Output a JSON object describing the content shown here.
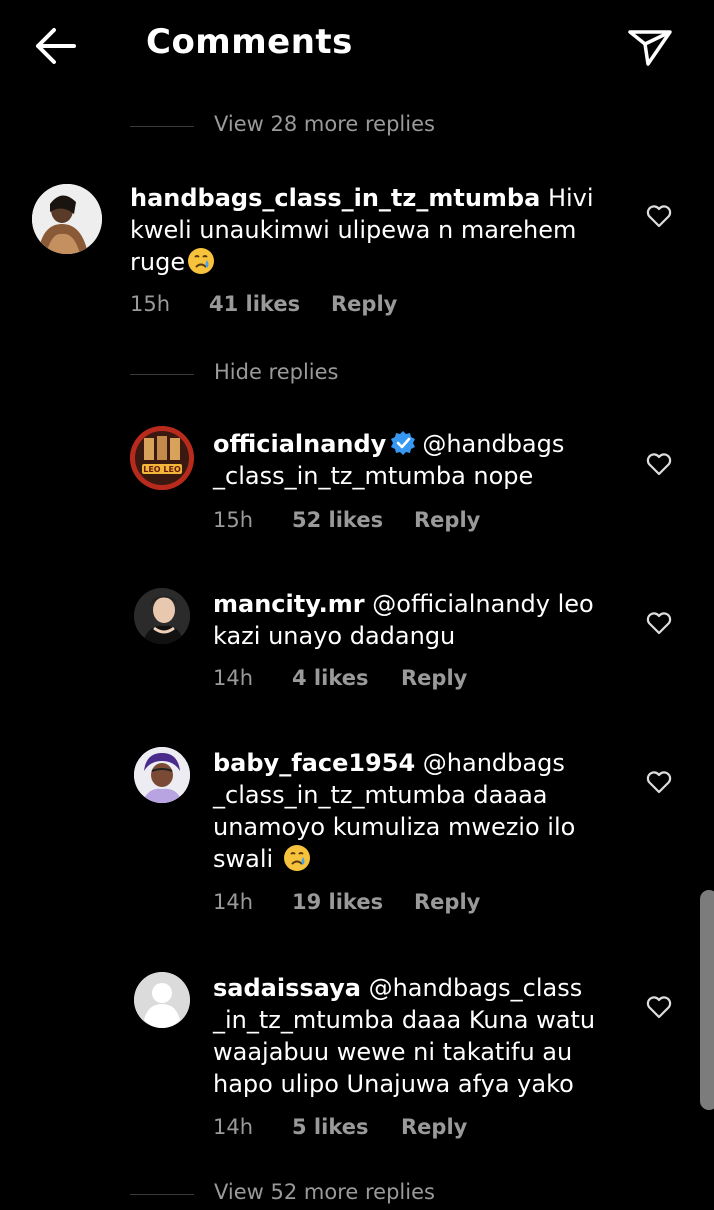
{
  "header": {
    "back_icon": "arrow-left-icon",
    "title": "Comments",
    "share_icon": "paper-plane-icon"
  },
  "colors": {
    "background": "#000000",
    "text": "#ffffff",
    "muted": "#9a9a9a",
    "verified": "#3897f0"
  },
  "threads": {
    "view_more_top": "View 28 more replies",
    "hide_replies": "Hide replies",
    "view_more_bottom": "View 52 more replies"
  },
  "comments": [
    {
      "username": "handbags_class_in_tz_mtumba",
      "lines": [
        "Hivi",
        "kweli unaukimwi ulipewa n marehem",
        "ruge"
      ],
      "time": "15h",
      "likes": "41 likes",
      "reply": "Reply",
      "emoji": "crying-face"
    },
    {
      "username": "officialnandy",
      "verified": true,
      "avatar_text": "LEO LEO",
      "lines": [
        "@handbags",
        "_class_in_tz_mtumba nope"
      ],
      "time": "15h",
      "likes": "52 likes",
      "reply": "Reply"
    },
    {
      "username": "mancity.mr",
      "lines": [
        "@officialnandy leo",
        "kazi unayo dadangu"
      ],
      "time": "14h",
      "likes": "4 likes",
      "reply": "Reply"
    },
    {
      "username": "baby_face1954",
      "lines": [
        "@handbags",
        "_class_in_tz_mtumba daaaa",
        "unamoyo  kumuliza mwezio  ilo",
        "swali"
      ],
      "time": "14h",
      "likes": "19 likes",
      "reply": "Reply",
      "emoji": "crying-face"
    },
    {
      "username": "sadaissaya",
      "lines": [
        "@handbags_class",
        "_in_tz_mtumba daaa Kuna watu",
        "waajabuu wewe ni takatifu au",
        "hapo ulipo Unajuwa afya yako"
      ],
      "time": "14h",
      "likes": "5 likes",
      "reply": "Reply"
    }
  ]
}
